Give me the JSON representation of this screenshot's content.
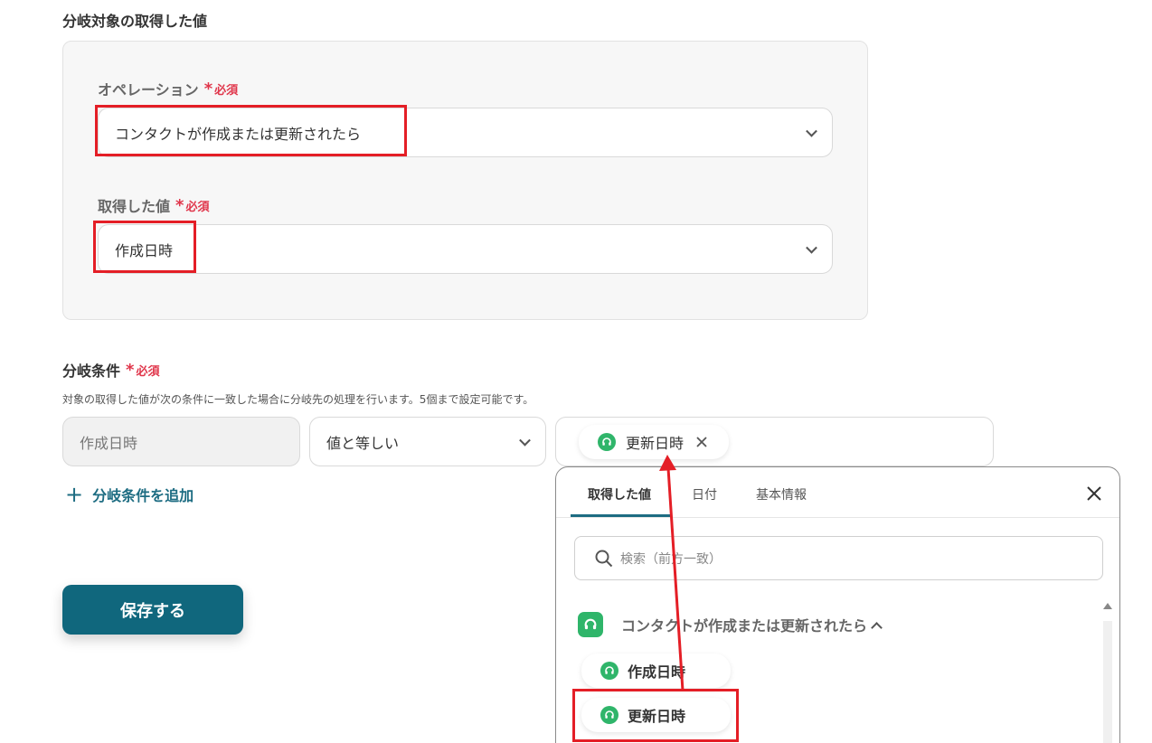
{
  "section": {
    "title": "分岐対象の取得した値"
  },
  "operation": {
    "label": "オペレーション",
    "required_star": "*",
    "required_text": "必須",
    "value": "コンタクトが作成または更新されたら"
  },
  "acquired_value": {
    "label": "取得した値",
    "required_star": "*",
    "required_text": "必須",
    "value": "作成日時"
  },
  "condition": {
    "label": "分岐条件",
    "required_star": "*",
    "required_text": "必須",
    "description": "対象の取得した値が次の条件に一致した場合に分岐先の処理を行います。5個まで設定可能です。",
    "target_value": "作成日時",
    "operator": "値と等しい",
    "compare_chip": "更新日時",
    "add_plus": "+",
    "add_label": "分岐条件を追加"
  },
  "save_button": "保存する",
  "picker": {
    "tabs": [
      "取得した値",
      "日付",
      "基本情報"
    ],
    "search_placeholder": "検索（前方一致）",
    "group_title": "コンタクトが作成または更新されたら",
    "items": [
      "作成日時",
      "更新日時"
    ]
  },
  "colors": {
    "accent": "#10677d",
    "required": "#e0364b",
    "annotation": "#e41e26",
    "app_green": "#2fb56a"
  },
  "icons": {
    "app": "headset-app-icon",
    "search": "search-icon",
    "close": "close-icon",
    "chevron": "chevron-down-icon"
  }
}
